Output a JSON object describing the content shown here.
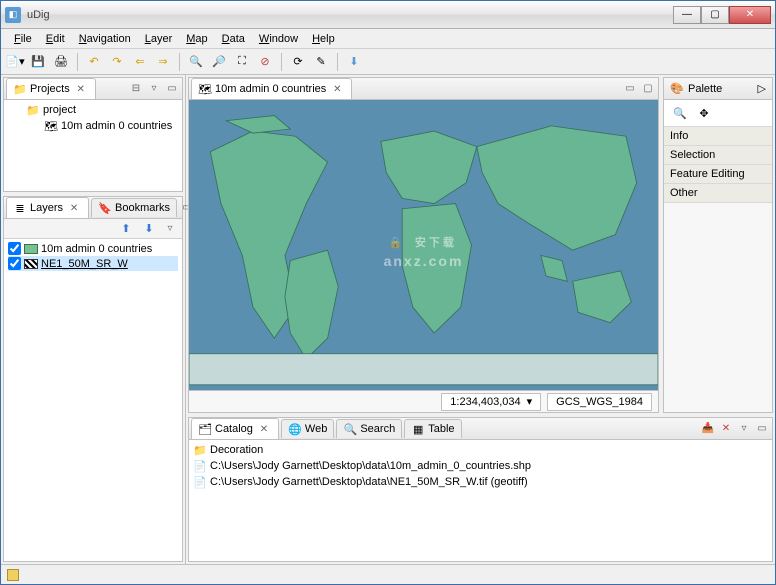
{
  "window": {
    "title": "uDig"
  },
  "menu": {
    "file": "File",
    "edit": "Edit",
    "navigation": "Navigation",
    "layer": "Layer",
    "map": "Map",
    "data": "Data",
    "window": "Window",
    "help": "Help"
  },
  "projects": {
    "tab": "Projects",
    "root": "project",
    "child": "10m admin 0 countries"
  },
  "layers": {
    "tab": "Layers",
    "bookmarks_tab": "Bookmarks",
    "items": [
      {
        "checked": true,
        "name": "10m admin 0 countries"
      },
      {
        "checked": true,
        "name": "NE1_50M_SR_W"
      }
    ]
  },
  "editor": {
    "tab": "10m admin 0 countries",
    "scale": "1:234,403,034",
    "crs": "GCS_WGS_1984"
  },
  "palette": {
    "title": "Palette",
    "groups": [
      "Info",
      "Selection",
      "Feature Editing",
      "Other"
    ]
  },
  "catalog": {
    "tab": "Catalog",
    "web_tab": "Web",
    "search_tab": "Search",
    "table_tab": "Table",
    "items": [
      "Decoration",
      "C:\\Users\\Jody Garnett\\Desktop\\data\\10m_admin_0_countries.shp",
      "C:\\Users\\Jody Garnett\\Desktop\\data\\NE1_50M_SR_W.tif (geotiff)"
    ]
  },
  "watermark": {
    "main": "安下载",
    "sub": "anxz.com"
  }
}
